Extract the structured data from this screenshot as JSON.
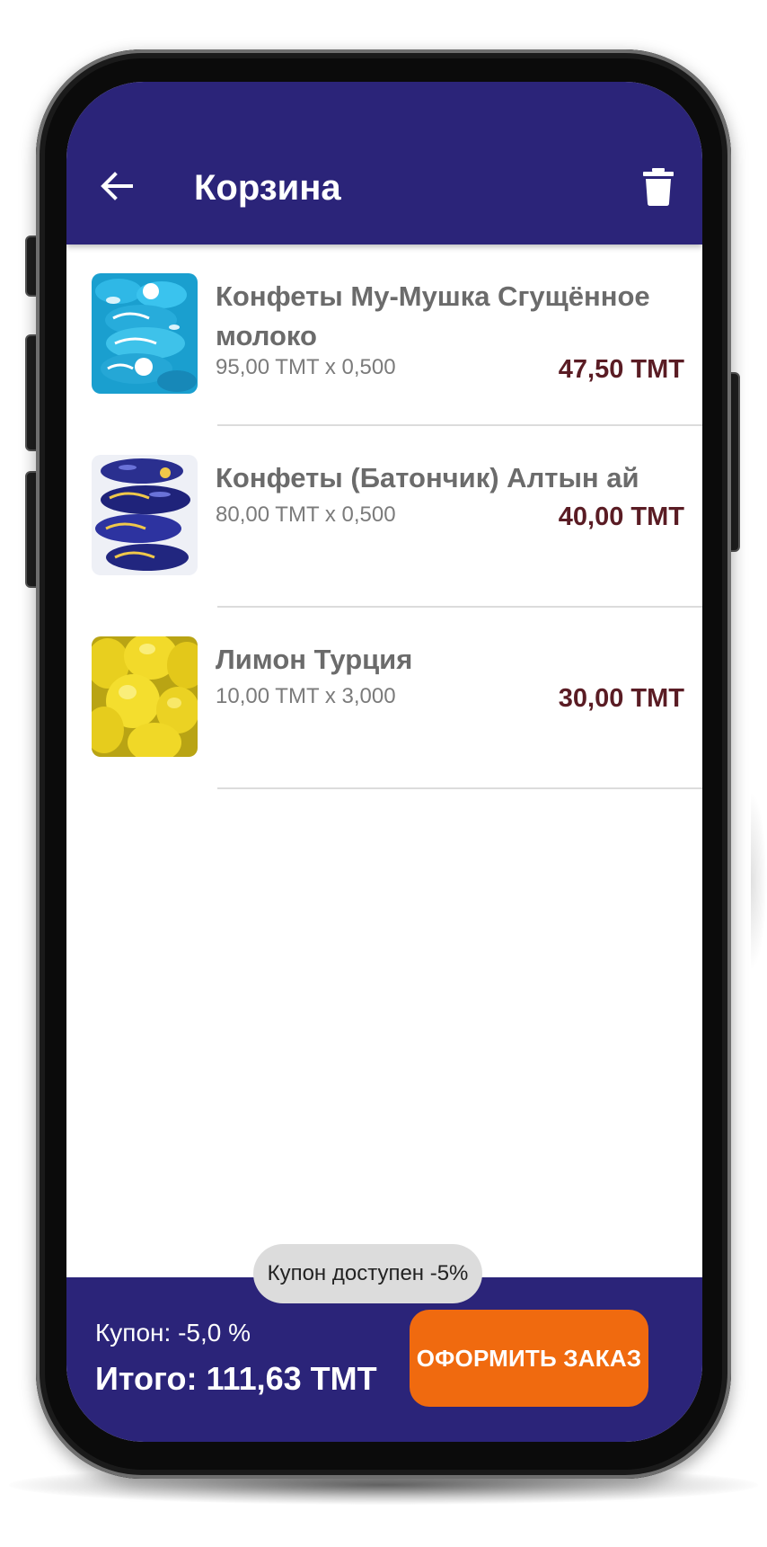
{
  "appbar": {
    "title": "Корзина",
    "back_icon": "arrow-left-icon",
    "delete_icon": "trash-icon",
    "color": "#2b2479"
  },
  "cart": {
    "items": [
      {
        "name": "Конфеты Му-Мушка Сгущённое молоко",
        "quantity_text": "95,00 TMT x 0,500",
        "total": "47,50 TMT",
        "image": "blue-wrapped-candies"
      },
      {
        "name": "Конфеты (Батончик) Алтын ай",
        "quantity_text": "80,00 TMT x 0,500",
        "total": "40,00 TMT",
        "image": "dark-blue-wrapped-candy-bars"
      },
      {
        "name": "Лимон Турция",
        "quantity_text": "10,00 TMT x 3,000",
        "total": "30,00 TMT",
        "image": "lemons"
      }
    ]
  },
  "bottom_bar": {
    "coupon": "Купон: -5,0 %",
    "total": "Итого: 111,63 TMT",
    "order_button": "ОФОРМИТЬ ЗАКАЗ"
  },
  "toast": {
    "text": "Купон доступен -5%"
  },
  "colors": {
    "primary": "#2b2479",
    "accent": "#f06a0f",
    "price": "#5a1c24"
  }
}
